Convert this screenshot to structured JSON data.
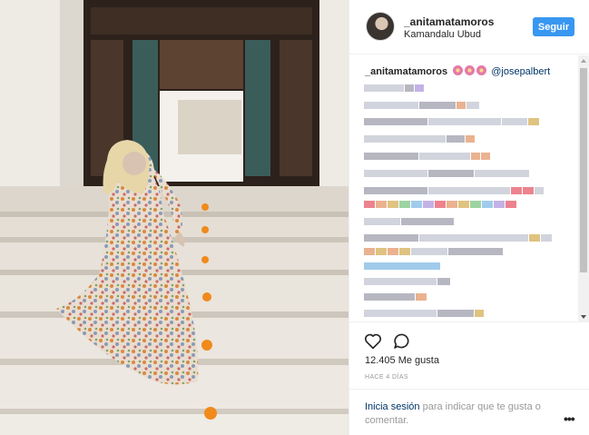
{
  "post": {
    "username": "_anitamatamoros",
    "location": "Kamandalu Ubud",
    "follow_label": "Seguir",
    "caption_username": "_anitamatamoros",
    "caption_mention": "@josepalbert",
    "likes": "12.405 Me gusta",
    "time_ago": "HACE 4 DÍAS",
    "login_link": "Inicia sesión",
    "login_rest": " para indicar que te gusta o comentar.",
    "more_label": "•••"
  },
  "icons": {
    "like": "heart-outline-icon",
    "comment": "speech-bubble-icon",
    "more": "ellipsis-icon",
    "emoji": "flower-emoji-icon"
  },
  "colors": {
    "accent": "#3897f0",
    "link": "#003569",
    "muted": "#999999"
  }
}
